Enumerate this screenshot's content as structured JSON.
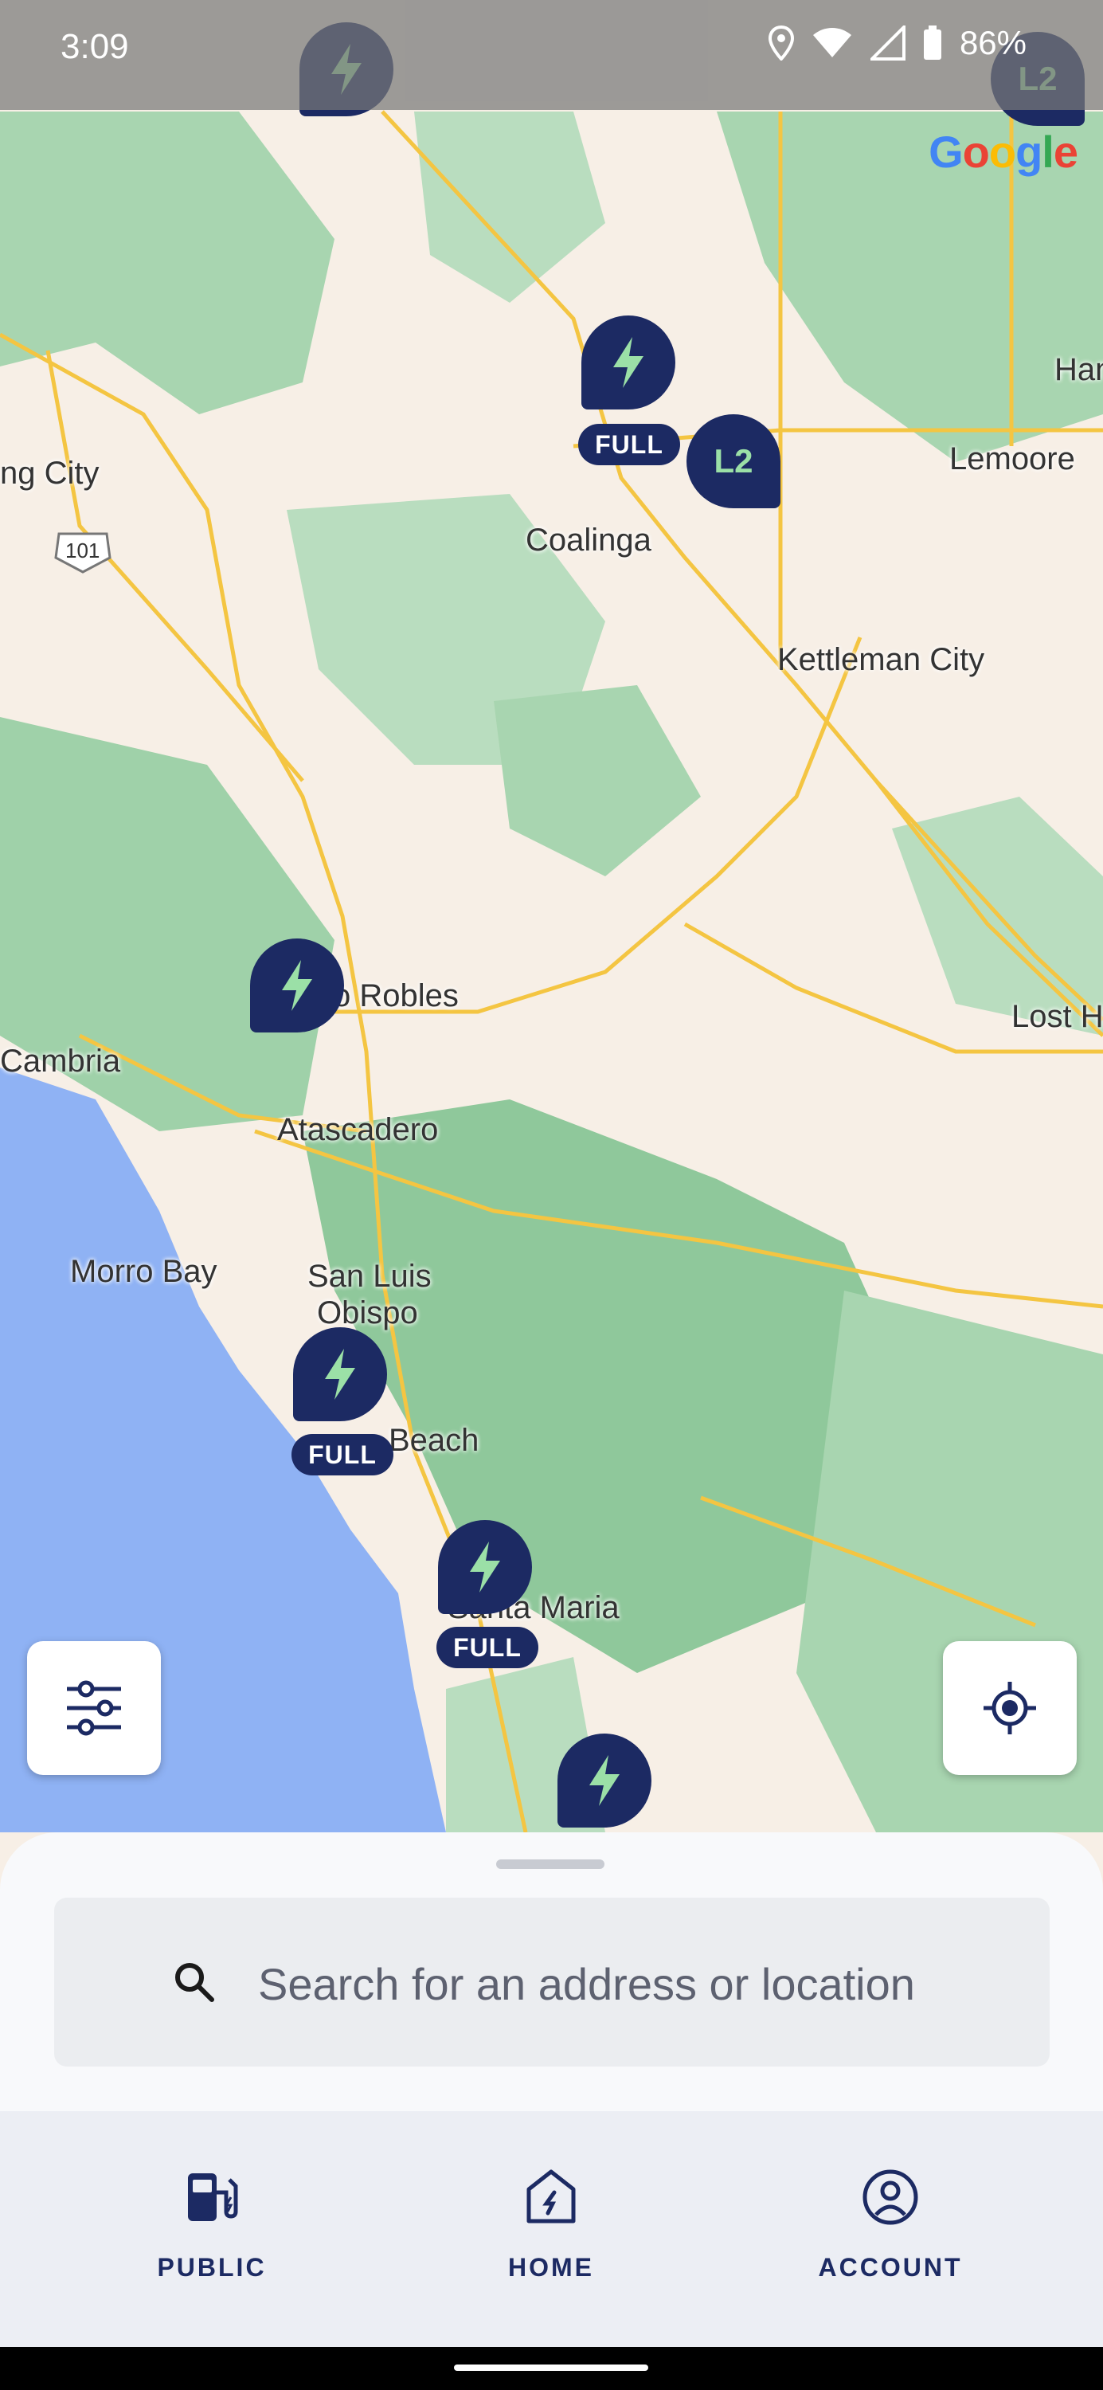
{
  "status_bar": {
    "time": "3:09",
    "battery_percent": "86%"
  },
  "map": {
    "attribution": "Google",
    "labels": [
      "Coalinga",
      "Kettleman City",
      "Lemoore",
      "ng City",
      "Han",
      "o Robles",
      "Cambria",
      "Atascadero",
      "Morro Bay",
      "San Luis",
      "Obispo",
      "Beach",
      "Santa Maria",
      "Lost H",
      "101",
      "L2"
    ],
    "pins": [
      {
        "type": "charger",
        "status": ""
      },
      {
        "type": "charger",
        "status": "FULL"
      },
      {
        "type": "level2",
        "label": "L2"
      },
      {
        "type": "charger",
        "status": ""
      },
      {
        "type": "charger",
        "status": "FULL"
      },
      {
        "type": "charger",
        "status": "FULL"
      },
      {
        "type": "charger",
        "status": ""
      }
    ],
    "full_badge": "FULL",
    "colors": {
      "pin": "#1c2a63",
      "bolt": "#9be0a7",
      "water": "#8fb2f4",
      "park": "#a8d5b0",
      "land": "#f7efe6",
      "road": "#f4c542"
    }
  },
  "controls": {
    "filter_icon": "sliders-icon",
    "locate_icon": "my-location-icon"
  },
  "search": {
    "placeholder": "Search for an address or location"
  },
  "nav": {
    "items": [
      {
        "label": "PUBLIC",
        "icon": "fuel-pump-icon"
      },
      {
        "label": "HOME",
        "icon": "home-charger-icon"
      },
      {
        "label": "ACCOUNT",
        "icon": "account-icon"
      }
    ]
  }
}
